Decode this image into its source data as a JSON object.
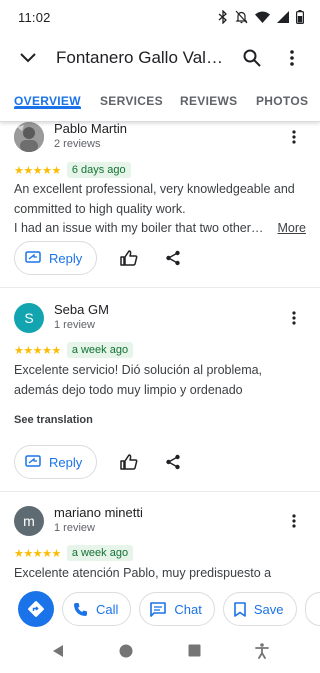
{
  "status": {
    "time": "11:02"
  },
  "header": {
    "title": "Fontanero Gallo Valen…"
  },
  "tabs": [
    {
      "label": "OVERVIEW",
      "active": true
    },
    {
      "label": "SERVICES",
      "active": false
    },
    {
      "label": "REVIEWS",
      "active": false
    },
    {
      "label": "PHOTOS",
      "active": false
    }
  ],
  "reviews": [
    {
      "name": "Pablo Martin",
      "count": "2 reviews",
      "stars": "★★★★★",
      "when": "6 days ago",
      "lines": [
        "An excellent professional, very knowledgeable and",
        "committed to high quality work."
      ],
      "truncated": "I had an issue with my boiler that two other…",
      "more": "More",
      "reply": "Reply"
    },
    {
      "name": "Seba GM",
      "initial": "S",
      "count": "1 review",
      "stars": "★★★★★",
      "when": "a week ago",
      "lines": [
        "Excelente servicio! Dió solución al problema,",
        "además dejo todo muy limpio y ordenado"
      ],
      "translate": "See translation",
      "reply": "Reply"
    },
    {
      "name": "mariano minetti",
      "initial": "m",
      "count": "1 review",
      "stars": "★★★★★",
      "when": "a week ago",
      "lines": [
        "Excelente atención Pablo, muy predispuesto a"
      ]
    }
  ],
  "bottom_actions": {
    "call": "Call",
    "chat": "Chat",
    "save": "Save"
  },
  "colors": {
    "accent": "#1a73e8",
    "star": "#fbbc04",
    "seba_avatar": "#12a4af",
    "mariano_avatar": "#5f6b73"
  }
}
